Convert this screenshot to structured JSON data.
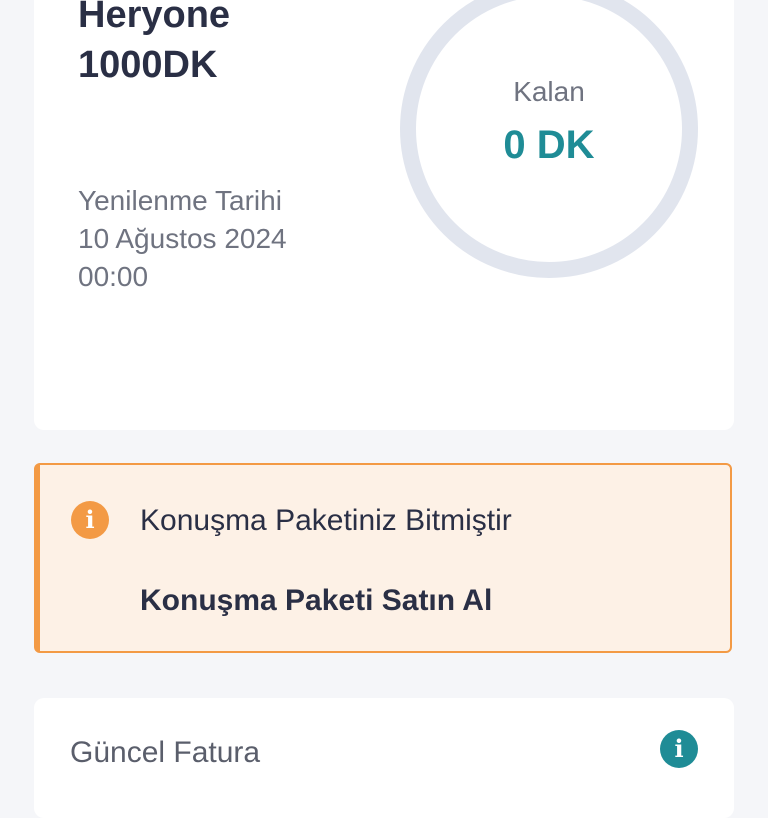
{
  "package": {
    "name": "Heryone\n1000DK",
    "renewal_label": "Yenilenme Tarihi",
    "renewal_date": "10 Ağustos 2024",
    "renewal_time": "00:00",
    "remaining_label": "Kalan",
    "remaining_value": "0 DK",
    "remaining_fraction": 0
  },
  "alert": {
    "icon": "info-icon",
    "message": "Konuşma Paketiniz Bitmiştir",
    "action_label": "Konuşma Paketi Satın Al"
  },
  "bill": {
    "title": "Güncel Fatura",
    "icon": "info-icon"
  },
  "colors": {
    "accent": "#1f8c96",
    "warning": "#f39a45",
    "warning_bg": "#fdf1e6",
    "ring_track": "#e1e5ee"
  }
}
